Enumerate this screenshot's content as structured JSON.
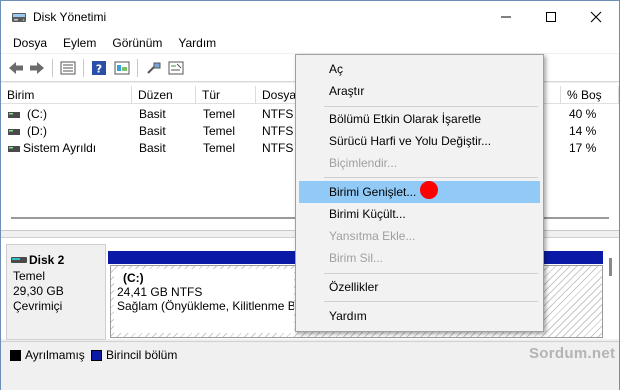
{
  "window": {
    "title": "Disk Yönetimi",
    "minimize_icon": "minimize-icon",
    "maximize_icon": "maximize-icon",
    "close_icon": "close-icon"
  },
  "menubar": {
    "items": [
      {
        "label": "Dosya"
      },
      {
        "label": "Eylem"
      },
      {
        "label": "Görünüm"
      },
      {
        "label": "Yardım"
      }
    ]
  },
  "toolbar": {
    "icons": [
      "back-arrow-icon",
      "forward-arrow-icon",
      "disk-list-icon",
      "help-icon",
      "properties-icon",
      "connect-icon",
      "settings-icon"
    ]
  },
  "volume_list": {
    "columns": [
      "Birim",
      "Düzen",
      "Tür",
      "Dosya",
      "",
      "% Boş"
    ],
    "rows": [
      {
        "name": "(C:)",
        "layout": "Basit",
        "type": "Temel",
        "fs": "NTFS",
        "free_pct": "40 %"
      },
      {
        "name": "(D:)",
        "layout": "Basit",
        "type": "Temel",
        "fs": "NTFS",
        "free_pct": "14 %"
      },
      {
        "name": "Sistem Ayrıldı",
        "layout": "Basit",
        "type": "Temel",
        "fs": "NTFS",
        "free_pct": "17 %"
      }
    ]
  },
  "disk": {
    "name": "Disk 2",
    "type": "Temel",
    "size": "29,30 GB",
    "status": "Çevrimiçi",
    "partition": {
      "label": "(C:)",
      "size_fs": "24,41 GB NTFS",
      "health": "Sağlam (Önyükleme, Kilitlenme Bi"
    }
  },
  "legend": {
    "unallocated": "Ayrılmamış",
    "primary": "Birincil bölüm",
    "unallocated_color": "#000000",
    "primary_color": "#0a1aa6"
  },
  "watermark": "Sordum.net",
  "context_menu": {
    "items": [
      {
        "label": "Aç"
      },
      {
        "label": "Araştır"
      },
      {
        "label": "Bölümü Etkin Olarak İşaretle"
      },
      {
        "label": "Sürücü Harfi ve Yolu Değiştir..."
      },
      {
        "label": "Biçimlendir..."
      },
      {
        "label": "Birimi Genişlet..."
      },
      {
        "label": "Birimi Küçült..."
      },
      {
        "label": "Yansıtma Ekle..."
      },
      {
        "label": "Birim Sil..."
      },
      {
        "label": "Özellikler"
      },
      {
        "label": "Yardım"
      }
    ],
    "highlight_color": "#91c9f7",
    "marker_color": "#ff0000"
  }
}
